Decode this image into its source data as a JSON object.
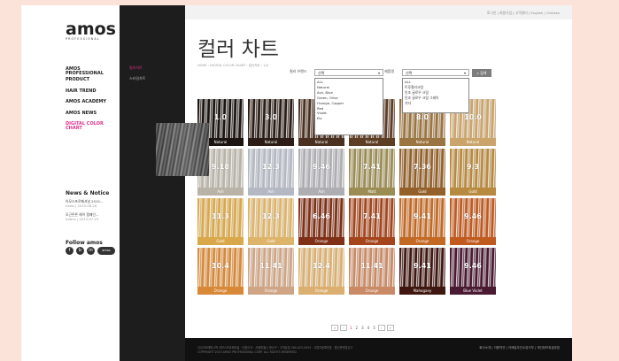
{
  "brand": {
    "logo": "amos",
    "sub": "PROFESSIONAL"
  },
  "main_nav": [
    {
      "label": "AMOS PROFESSIONAL",
      "active": false
    },
    {
      "label": "PRODUCT",
      "active": false
    },
    {
      "label": "HAIR TREND",
      "active": false
    },
    {
      "label": "AMOS ACADEMY",
      "active": false
    },
    {
      "label": "AMOS NEWS",
      "active": false
    },
    {
      "label": "DIGITAL COLOR CHART",
      "active": true
    }
  ],
  "sub_nav": [
    {
      "label": "컬러차트",
      "active": true
    },
    {
      "label": "스타일차트",
      "active": false
    }
  ],
  "news": {
    "title": "News & Notice",
    "items": [
      {
        "title": "아모스프로페셔널 2015...",
        "meta": "news | 2015.08.26"
      },
      {
        "title": "모근튼튼 헤어 캠페인...",
        "meta": "notice | 2015.07.23"
      }
    ]
  },
  "follow": {
    "title": "Follow amos",
    "icons": [
      "f",
      "b",
      "in",
      "amos"
    ]
  },
  "top_links": "로그인 | 회원가입 | 고객센터 | English | Chinese",
  "page_title": "컬러 차트",
  "breadcrumb": "HOME › DIGITAL COLOR CHART › 컬러차트 › 1/4",
  "filters": {
    "color_label": "컬러 브랜드",
    "color_selected": "선택",
    "color_options": [
      "ALL",
      "Natural",
      "Ash, Blue",
      "Green, Olive",
      "Orange, Copper",
      "Red",
      "Violet",
      "Etc"
    ],
    "product_label": "제품명",
    "product_selected": "선택",
    "product_options": [
      "ALL",
      "트루컬러크림",
      "인조 글로우 크림",
      "인조 글로우 크림 그레이",
      "기타"
    ],
    "search_label": "검색"
  },
  "swatches": [
    [
      {
        "num": "1.0",
        "label": "Natural",
        "color": "#1b1410"
      },
      {
        "num": "3.0",
        "label": "Natural",
        "color": "#2b1d15"
      },
      {
        "num": "5.0",
        "label": "Natural",
        "color": "#4a3020"
      },
      {
        "num": "6.0",
        "label": "Natural",
        "color": "#5e3d25"
      },
      {
        "num": "8.0",
        "label": "Natural",
        "color": "#9b7441"
      },
      {
        "num": "10.0",
        "label": "Natural",
        "color": "#caa46a"
      }
    ],
    [
      {
        "num": "9.18",
        "label": "Ash",
        "color": "#b9b3a7"
      },
      {
        "num": "12.3",
        "label": "Ash",
        "color": "#b3b8c2"
      },
      {
        "num": "9.46",
        "label": "Ash",
        "color": "#aeadb1"
      },
      {
        "num": "7.41",
        "label": "Matt",
        "color": "#9b8c54"
      },
      {
        "num": "7.36",
        "label": "Gold",
        "color": "#93602a"
      },
      {
        "num": "9.3",
        "label": "Gold",
        "color": "#b88a3f"
      }
    ],
    [
      {
        "num": "11.3",
        "label": "Gold",
        "color": "#d9a84a"
      },
      {
        "num": "12.3",
        "label": "Gold",
        "color": "#ddb46a"
      },
      {
        "num": "6.46",
        "label": "Orange",
        "color": "#7f3016"
      },
      {
        "num": "7.41",
        "label": "Orange",
        "color": "#a4451c"
      },
      {
        "num": "9.41",
        "label": "Orange",
        "color": "#c36924"
      },
      {
        "num": "9.46",
        "label": "Orange",
        "color": "#c05a1f"
      }
    ],
    [
      {
        "num": "10.4",
        "label": "Orange",
        "color": "#d88938"
      },
      {
        "num": "11.41",
        "label": "Orange",
        "color": "#cfa585"
      },
      {
        "num": "12.4",
        "label": "Orange",
        "color": "#dbaf70"
      },
      {
        "num": "11.41",
        "label": "Orange",
        "color": "#c98a65"
      },
      {
        "num": "9.41",
        "label": "Mahogany",
        "color": "#3f1610"
      },
      {
        "num": "9.46",
        "label": "Blue Violet",
        "color": "#4a1a33"
      }
    ]
  ],
  "pagination": {
    "first": "«",
    "prev": "‹",
    "pages": [
      "1",
      "2",
      "3",
      "4",
      "5"
    ],
    "active": "1",
    "next": "›",
    "last": "»"
  },
  "footer": {
    "address": "(주)아모레퍼시픽 아모스프로페셔널 · 대표이사 · 서울특별시 용산구 · 고객상담 080-023-5454 · 사업자등록번호 · 통신판매업신고",
    "copyright": "COPYRIGHT 2015 AMOS PROFESSIONAL CORP. ALL RIGHTS RESERVED.",
    "links": "회사소개 | 이용약관 | 이메일무단수집거부 | 개인정보취급방침"
  }
}
